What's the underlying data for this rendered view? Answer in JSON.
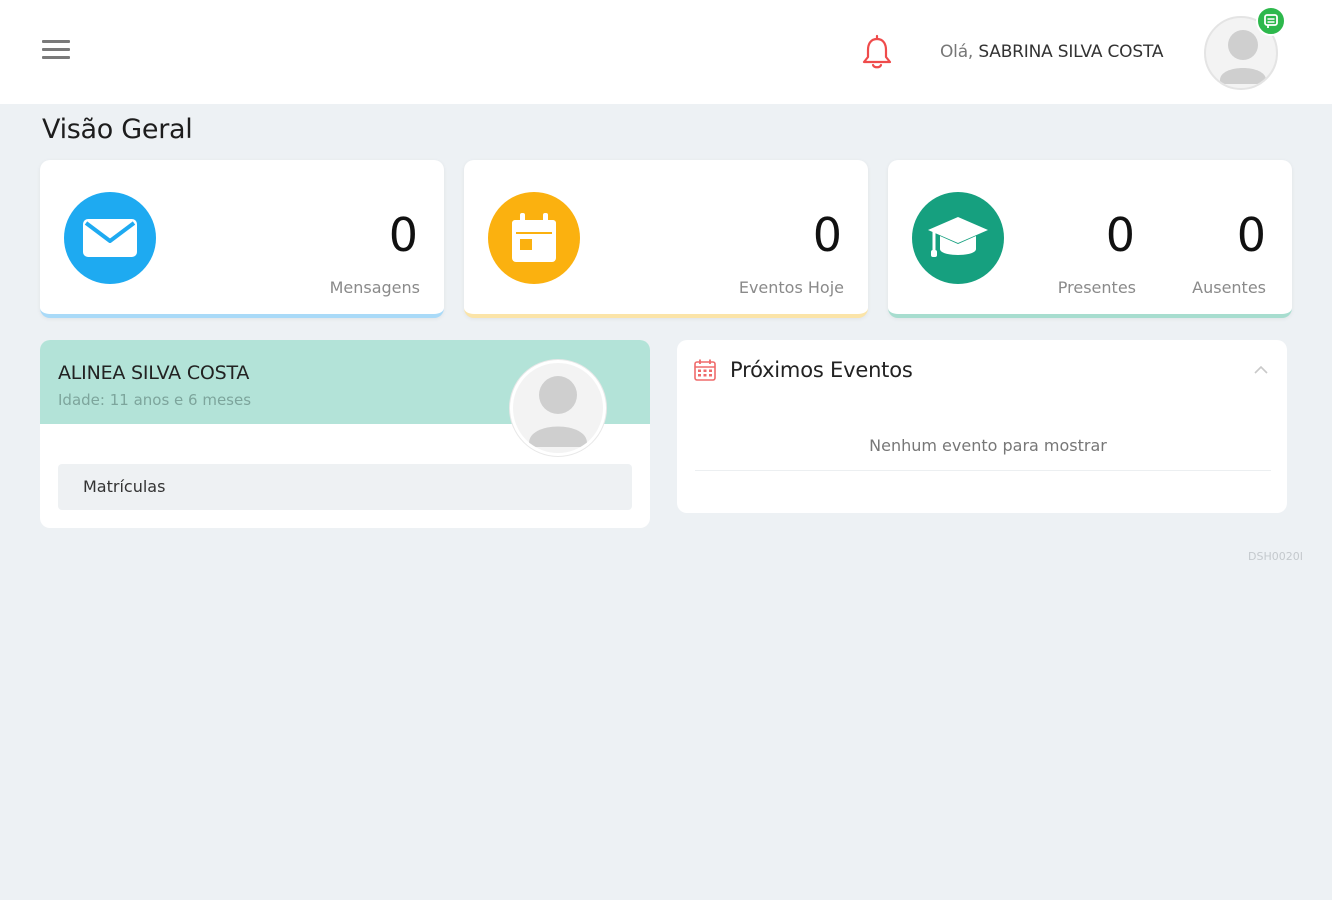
{
  "header": {
    "greeting_prefix": "Olá,",
    "user_name": "SABRINA SILVA COSTA"
  },
  "page": {
    "title": "Visão Geral",
    "screen_code": "DSH0020I"
  },
  "stats": {
    "messages": {
      "value": "0",
      "label": "Mensagens",
      "color": "#1eaaf1"
    },
    "events_today": {
      "value": "0",
      "label": "Eventos Hoje",
      "color": "#fbb10f"
    },
    "present": {
      "value": "0",
      "label": "Presentes"
    },
    "absent": {
      "value": "0",
      "label": "Ausentes"
    },
    "attendance_color": "#16a07f"
  },
  "student": {
    "name": "ALINEA SILVA COSTA",
    "age": "Idade: 11 anos e 6 meses",
    "enrollments_label": "Matrículas"
  },
  "events": {
    "title": "Próximos Eventos",
    "empty_text": "Nenhum evento para mostrar"
  },
  "icons": {
    "menu": "hamburger-icon",
    "notifications": "bell-icon",
    "message_badge": "chat-icon",
    "messages": "envelope-icon",
    "events": "calendar-icon",
    "attendance": "graduation-cap-icon",
    "collapse": "chevron-up-icon"
  }
}
